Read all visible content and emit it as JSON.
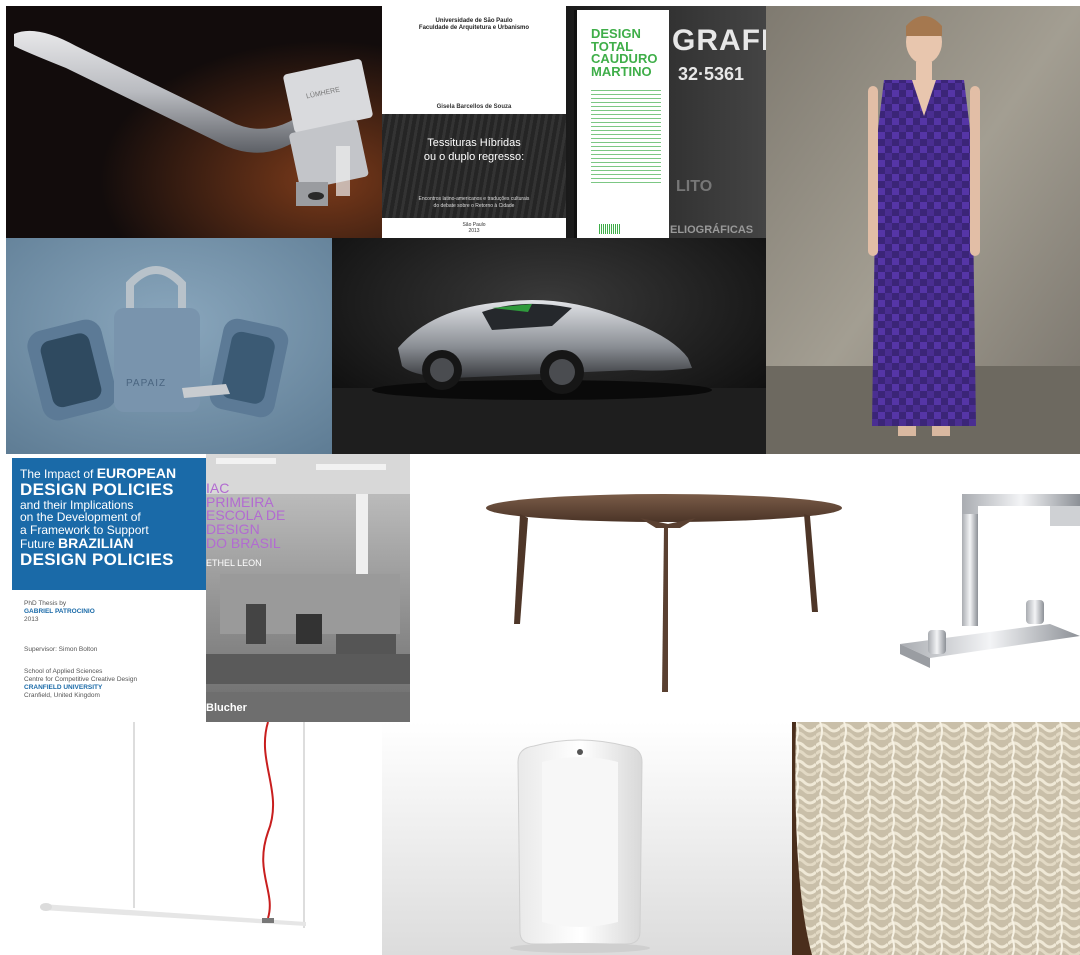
{
  "tiles": {
    "handle": {
      "brand": "LÜMHERE"
    },
    "book_tessituras": {
      "institution_line1": "Universidade de São Paulo",
      "institution_line2": "Faculdade de Arquitetura e Urbanismo",
      "author": "Gisela Barcellos de Souza",
      "title_line1": "Tessituras Híbridas",
      "title_line2": "ou o duplo regresso:",
      "subtitle_line1": "Encontros latino-americanos e traduções culturais",
      "subtitle_line2": "do debate sobre o Retorno à Cidade",
      "city": "São Paulo",
      "year": "2013"
    },
    "book_design_total": {
      "title_line1": "DESIGN",
      "title_line2": "TOTAL",
      "title_line3": "CAUDURO",
      "title_line4": "MARTINO",
      "poster_line1": "GRAFIA",
      "poster_line2": "32·5361",
      "poster_line3": "LITO",
      "poster_line4": "ELIOGRÁFICAS"
    },
    "padlock": {
      "brand": "PAPAIZ"
    },
    "thesis": {
      "line1_prefix": "The Impact of ",
      "line1_bold": "EUROPEAN",
      "line2": "DESIGN POLICIES",
      "line3": "and their Implications",
      "line4": "on the Development of",
      "line5": "a Framework to Support",
      "line6_prefix": "Future ",
      "line6_bold": "BRAZILIAN",
      "line7": "DESIGN POLICIES",
      "meta1": "PhD Thesis by",
      "meta2": "GABRIEL PATROCINIO",
      "meta3": "2013",
      "meta4": "Supervisor: Simon Bolton",
      "meta5": "School of Applied Sciences",
      "meta6": "Centre for Competitive Creative Design",
      "meta7": "CRANFIELD UNIVERSITY",
      "meta8": "Cranfield, United Kingdom"
    },
    "book_iac": {
      "title_line1": "IAC",
      "title_line2": "PRIMEIRA",
      "title_line3": "ESCOLA DE",
      "title_line4": "DESIGN",
      "title_line5": "DO BRASIL",
      "author": "ETHEL LEON",
      "publisher": "Blucher"
    }
  },
  "colors": {
    "thesis_blue": "#1a6aa8",
    "book_green": "#3fae49",
    "dress_purple": "#4a2a8c",
    "lamp_red": "#c81e1e",
    "iac_purple": "#b26bd1"
  }
}
